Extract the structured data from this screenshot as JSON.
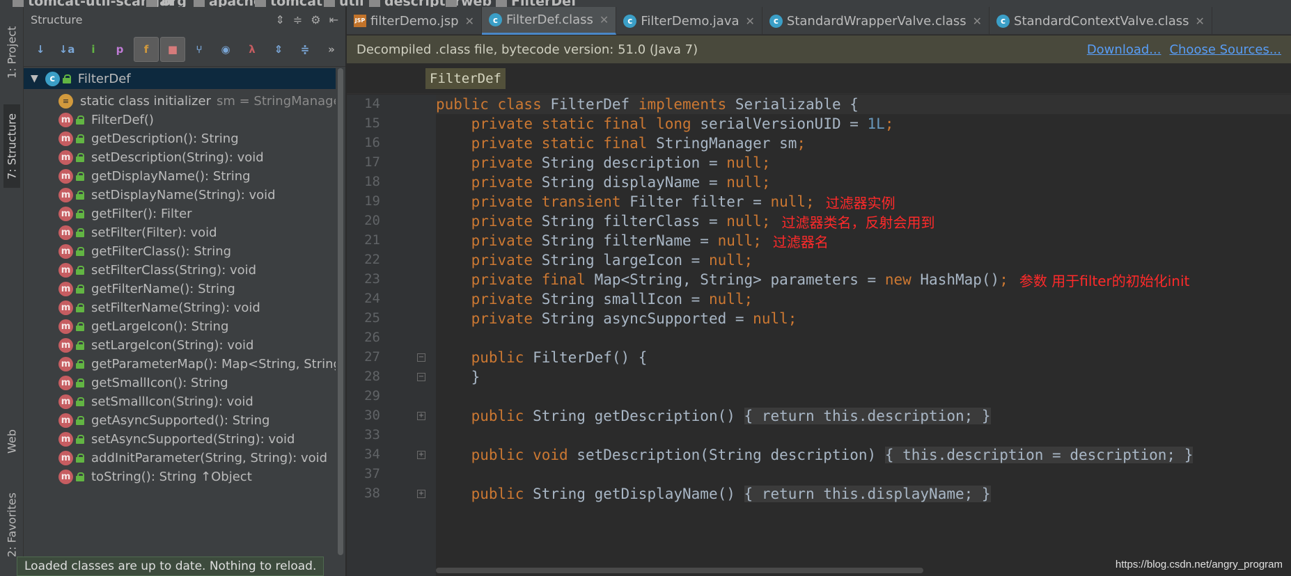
{
  "navbar": {
    "crumbs": [
      "tomcat-util-scan.jar",
      "org",
      "apache",
      "tomcat",
      "util",
      "descriptor",
      "web",
      "FilterDef"
    ]
  },
  "left_strip": {
    "tabs": [
      "1: Project",
      "7: Structure",
      "Web",
      "2: Favorites"
    ]
  },
  "structure": {
    "title": "Structure",
    "root": "FilterDef",
    "items": [
      {
        "label": "static class initializer",
        "suffix": "sm = StringManager.",
        "kind": "static"
      },
      {
        "label": "FilterDef()",
        "kind": "m"
      },
      {
        "label": "getDescription(): String",
        "kind": "m"
      },
      {
        "label": "setDescription(String): void",
        "kind": "m"
      },
      {
        "label": "getDisplayName(): String",
        "kind": "m"
      },
      {
        "label": "setDisplayName(String): void",
        "kind": "m"
      },
      {
        "label": "getFilter(): Filter",
        "kind": "m"
      },
      {
        "label": "setFilter(Filter): void",
        "kind": "m"
      },
      {
        "label": "getFilterClass(): String",
        "kind": "m"
      },
      {
        "label": "setFilterClass(String): void",
        "kind": "m"
      },
      {
        "label": "getFilterName(): String",
        "kind": "m"
      },
      {
        "label": "setFilterName(String): void",
        "kind": "m"
      },
      {
        "label": "getLargeIcon(): String",
        "kind": "m"
      },
      {
        "label": "setLargeIcon(String): void",
        "kind": "m"
      },
      {
        "label": "getParameterMap(): Map<String, String",
        "kind": "m"
      },
      {
        "label": "getSmallIcon(): String",
        "kind": "m"
      },
      {
        "label": "setSmallIcon(String): void",
        "kind": "m"
      },
      {
        "label": "getAsyncSupported(): String",
        "kind": "m"
      },
      {
        "label": "setAsyncSupported(String): void",
        "kind": "m"
      },
      {
        "label": "addInitParameter(String, String): void",
        "kind": "m"
      },
      {
        "label": "toString(): String ↑Object",
        "kind": "m"
      }
    ],
    "toast": "Loaded classes are up to date. Nothing to reload.",
    "icons": {
      "method": "m",
      "class": "c"
    }
  },
  "tabs": [
    {
      "label": "filterDemo.jsp",
      "icon": "jsp",
      "active": false
    },
    {
      "label": "FilterDef.class",
      "icon": "c",
      "active": true
    },
    {
      "label": "FilterDemo.java",
      "icon": "c",
      "active": false
    },
    {
      "label": "StandardWrapperValve.class",
      "icon": "c",
      "active": false
    },
    {
      "label": "StandardContextValve.class",
      "icon": "c",
      "active": false
    }
  ],
  "banner": {
    "text": "Decompiled .class file, bytecode version: 51.0 (Java 7)",
    "download": "Download...",
    "choose_sources": "Choose Sources..."
  },
  "classbar": {
    "name": "FilterDef"
  },
  "code": {
    "lines": [
      {
        "num": "14",
        "tokens": [
          [
            "k",
            "public class "
          ],
          [
            "t",
            "FilterDef "
          ],
          [
            "k",
            "implements "
          ],
          [
            "t",
            "Serializable {"
          ]
        ]
      },
      {
        "num": "15",
        "tokens": [
          [
            "t",
            "    "
          ],
          [
            "k",
            "private static final long "
          ],
          [
            "t",
            "serialVersionUID = "
          ],
          [
            "n",
            "1L"
          ],
          [
            "p",
            ";"
          ]
        ]
      },
      {
        "num": "16",
        "tokens": [
          [
            "t",
            "    "
          ],
          [
            "k",
            "private static final "
          ],
          [
            "t",
            "StringManager sm"
          ],
          [
            "p",
            ";"
          ]
        ]
      },
      {
        "num": "17",
        "tokens": [
          [
            "t",
            "    "
          ],
          [
            "k",
            "private "
          ],
          [
            "t",
            "String description = "
          ],
          [
            "k",
            "null"
          ],
          [
            "p",
            ";"
          ]
        ]
      },
      {
        "num": "18",
        "tokens": [
          [
            "t",
            "    "
          ],
          [
            "k",
            "private "
          ],
          [
            "t",
            "String displayName = "
          ],
          [
            "k",
            "null"
          ],
          [
            "p",
            ";"
          ]
        ]
      },
      {
        "num": "19",
        "tokens": [
          [
            "t",
            "    "
          ],
          [
            "k",
            "private transient "
          ],
          [
            "t",
            "Filter filter = "
          ],
          [
            "k",
            "null"
          ],
          [
            "p",
            ";"
          ]
        ],
        "note": "过滤器实例"
      },
      {
        "num": "20",
        "tokens": [
          [
            "t",
            "    "
          ],
          [
            "k",
            "private "
          ],
          [
            "t",
            "String filterClass = "
          ],
          [
            "k",
            "null"
          ],
          [
            "p",
            ";"
          ]
        ],
        "note": "过滤器类名，反射会用到"
      },
      {
        "num": "21",
        "tokens": [
          [
            "t",
            "    "
          ],
          [
            "k",
            "private "
          ],
          [
            "t",
            "String filterName = "
          ],
          [
            "k",
            "null"
          ],
          [
            "p",
            ";"
          ]
        ],
        "note": "过滤器名"
      },
      {
        "num": "22",
        "tokens": [
          [
            "t",
            "    "
          ],
          [
            "k",
            "private "
          ],
          [
            "t",
            "String largeIcon = "
          ],
          [
            "k",
            "null"
          ],
          [
            "p",
            ";"
          ]
        ]
      },
      {
        "num": "23",
        "tokens": [
          [
            "t",
            "    "
          ],
          [
            "k",
            "private final "
          ],
          [
            "t",
            "Map<String, String> parameters = "
          ],
          [
            "k",
            "new "
          ],
          [
            "t",
            "HashMap()"
          ],
          [
            "p",
            ";"
          ]
        ],
        "note": "参数 用于filter的初始化init"
      },
      {
        "num": "24",
        "tokens": [
          [
            "t",
            "    "
          ],
          [
            "k",
            "private "
          ],
          [
            "t",
            "String smallIcon = "
          ],
          [
            "k",
            "null"
          ],
          [
            "p",
            ";"
          ]
        ]
      },
      {
        "num": "25",
        "tokens": [
          [
            "t",
            "    "
          ],
          [
            "k",
            "private "
          ],
          [
            "t",
            "String asyncSupported = "
          ],
          [
            "k",
            "null"
          ],
          [
            "p",
            ";"
          ]
        ]
      },
      {
        "num": "26",
        "tokens": []
      },
      {
        "num": "27",
        "tokens": [
          [
            "t",
            "    "
          ],
          [
            "k",
            "public "
          ],
          [
            "t",
            "FilterDef() {"
          ]
        ]
      },
      {
        "num": "28",
        "tokens": [
          [
            "t",
            "    }"
          ]
        ]
      },
      {
        "num": "29",
        "tokens": []
      },
      {
        "num": "30",
        "tokens": [
          [
            "t",
            "    "
          ],
          [
            "k",
            "public "
          ],
          [
            "t",
            "String getDescription() "
          ],
          [
            "f",
            "{ "
          ],
          [
            "fk",
            "return this"
          ],
          [
            "f",
            ".description; }"
          ]
        ]
      },
      {
        "num": "33",
        "tokens": []
      },
      {
        "num": "34",
        "tokens": [
          [
            "t",
            "    "
          ],
          [
            "k",
            "public void "
          ],
          [
            "t",
            "setDescription(String description) "
          ],
          [
            "f",
            "{ "
          ],
          [
            "fk",
            "this"
          ],
          [
            "f",
            ".description = description; }"
          ]
        ]
      },
      {
        "num": "37",
        "tokens": []
      },
      {
        "num": "38",
        "tokens": [
          [
            "t",
            "    "
          ],
          [
            "k",
            "public "
          ],
          [
            "t",
            "String getDisplayName() "
          ],
          [
            "f",
            "{ "
          ],
          [
            "fk",
            "return this"
          ],
          [
            "f",
            ".displayName; }"
          ]
        ]
      }
    ]
  },
  "watermark": "https://blog.csdn.net/angry_program",
  "colors": {
    "keyword": "#cc7832",
    "number": "#6897bb",
    "text": "#a9b7c6",
    "annotation": "#ff2a2a",
    "banner_bg": "#49493c",
    "link": "#589df6"
  }
}
